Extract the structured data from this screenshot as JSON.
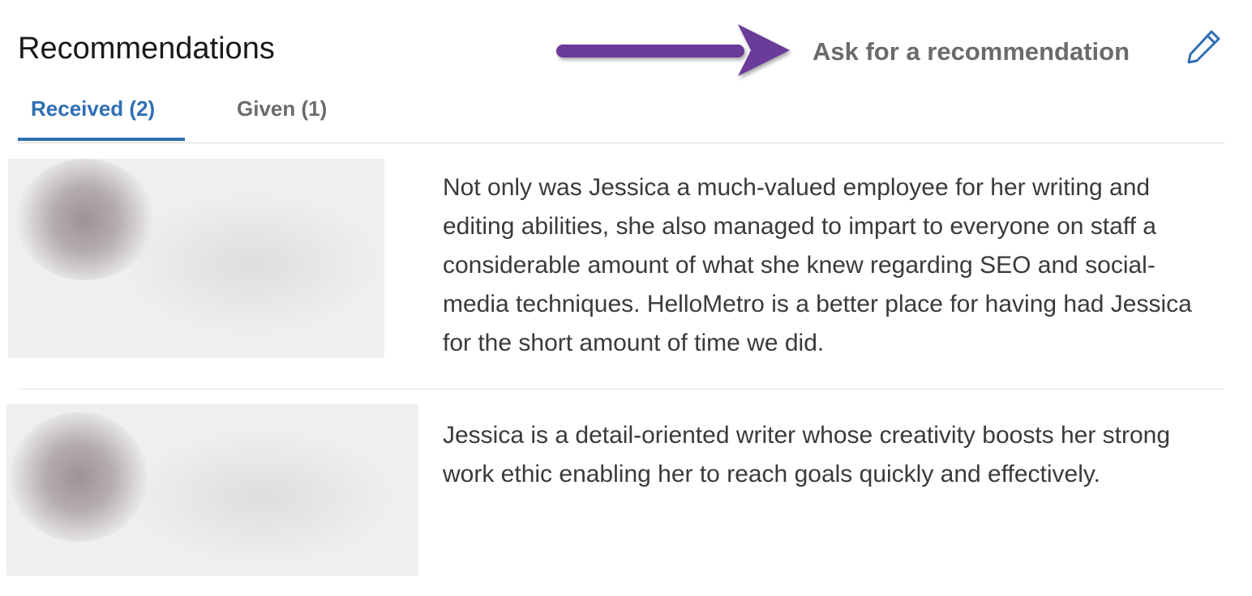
{
  "section": {
    "title": "Recommendations",
    "ask_link": "Ask for a recommendation",
    "edit_icon": "pencil-icon",
    "annotation_arrow_color": "#6b3b99"
  },
  "tabs": [
    {
      "label": "Received (2)",
      "active": true
    },
    {
      "label": "Given (1)",
      "active": false
    }
  ],
  "colors": {
    "active_tab": "#2f6fb3",
    "inactive_tab": "#6b6b6b",
    "body_text": "#3a3a3a"
  },
  "recommendations": [
    {
      "text": "Not only was Jessica a much-valued employee for her writing and editing abilities, she also managed to impart to everyone on staff a considerable amount of what she knew regarding SEO and social-media techniques. HelloMetro is a better place for having had Jessica for the short amount of time we did."
    },
    {
      "text": "Jessica is a detail-oriented writer whose creativity boosts her strong work ethic enabling her to reach goals quickly and effectively."
    }
  ]
}
